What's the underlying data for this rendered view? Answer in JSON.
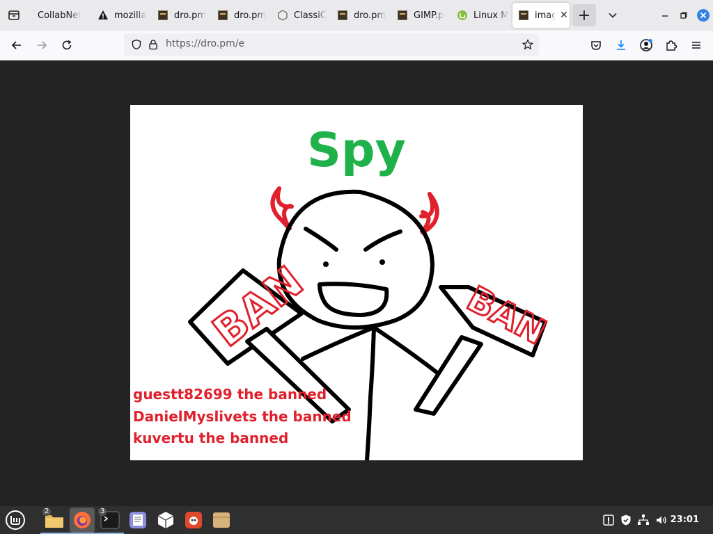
{
  "browser": {
    "tabs": [
      {
        "title": "CollabNet",
        "icon": "none",
        "active": false
      },
      {
        "title": "mozilla",
        "icon": "warning-icon",
        "active": false
      },
      {
        "title": "dro.pm",
        "icon": "dro-icon",
        "active": false
      },
      {
        "title": "dro.pm",
        "icon": "dro-icon",
        "active": false
      },
      {
        "title": "ClassiC",
        "icon": "cube-icon",
        "active": false
      },
      {
        "title": "dro.pm",
        "icon": "dro-icon",
        "active": false
      },
      {
        "title": "GIMP.p",
        "icon": "dro-icon",
        "active": false
      },
      {
        "title": "Linux M",
        "icon": "mint-icon",
        "active": false
      },
      {
        "title": "imag",
        "icon": "dro-icon",
        "active": true
      }
    ],
    "url": "https://dro.pm/e"
  },
  "image": {
    "title": "Spy",
    "sign_left": "BAN",
    "sign_right": "BAN",
    "captions": [
      "guestt82699 the banned",
      "DanielMyslivets the banned",
      "kuvertu the banned"
    ],
    "colors": {
      "title": "#1fb24a",
      "caption": "#e0202c",
      "horns": "#e0202c"
    }
  },
  "taskbar": {
    "apps": [
      {
        "name": "menu",
        "badge": ""
      },
      {
        "name": "files",
        "badge": "2"
      },
      {
        "name": "firefox",
        "badge": ""
      },
      {
        "name": "terminal",
        "badge": "3"
      },
      {
        "name": "text-editor",
        "badge": ""
      },
      {
        "name": "app-center",
        "badge": ""
      },
      {
        "name": "gimp",
        "badge": ""
      },
      {
        "name": "archive",
        "badge": ""
      }
    ],
    "clock": "23:01"
  }
}
